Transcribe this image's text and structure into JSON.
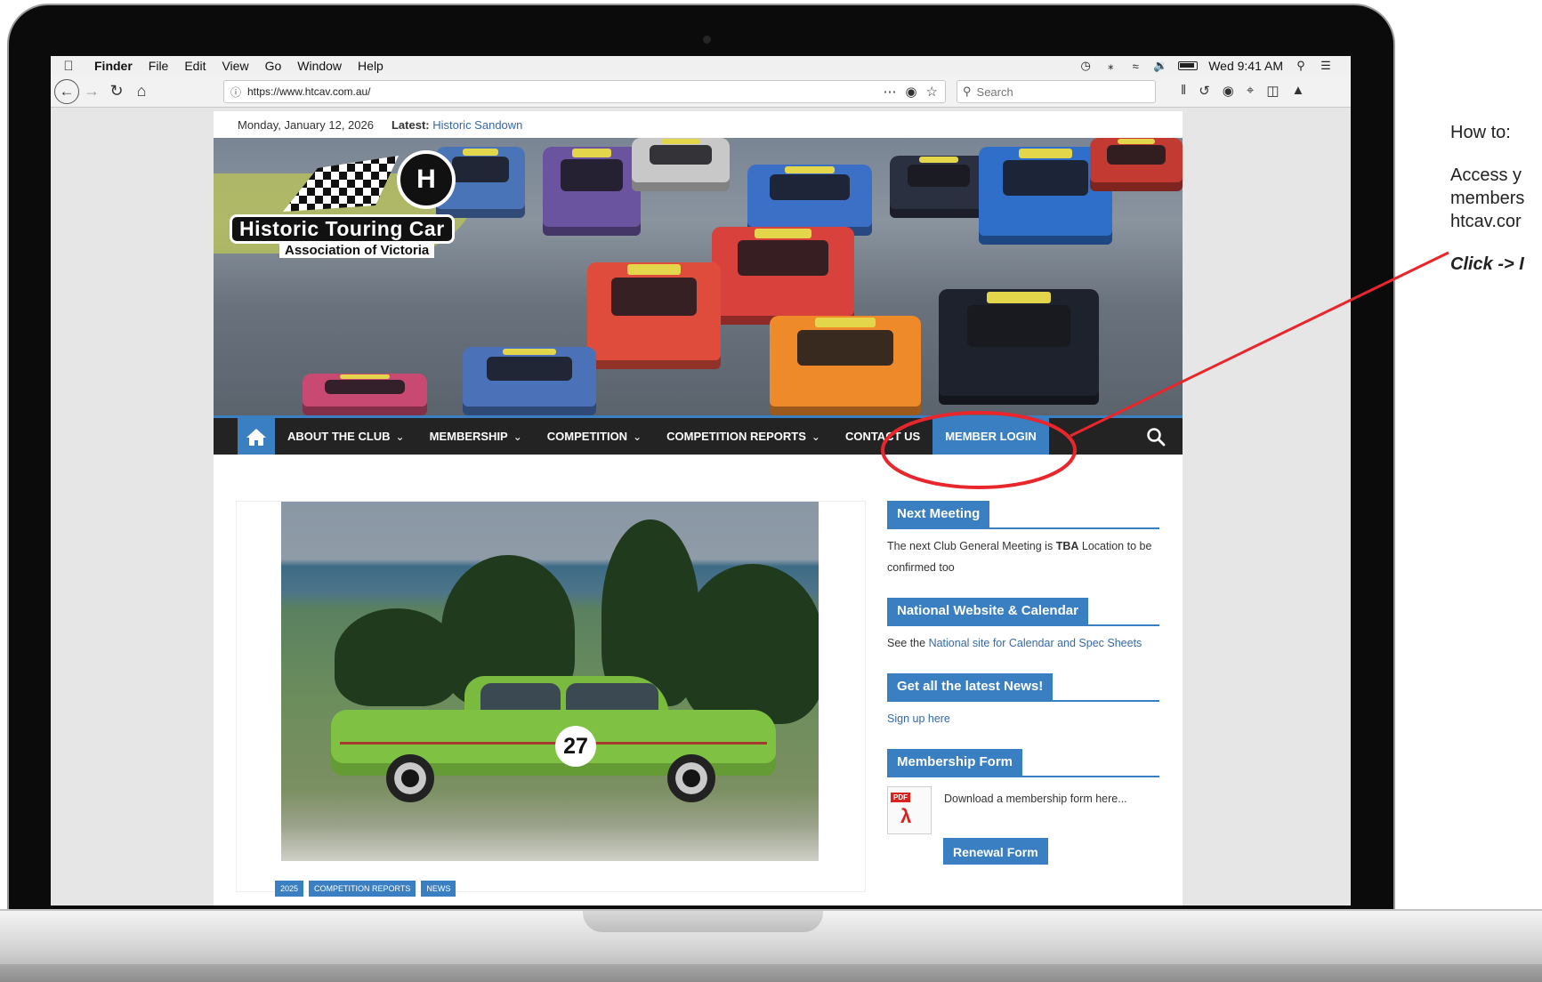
{
  "menubar": {
    "app": "Finder",
    "items": [
      "File",
      "Edit",
      "View",
      "Go",
      "Window",
      "Help"
    ],
    "clock": "Wed 9:41 AM"
  },
  "browser": {
    "url": "https://www.htcav.com.au/",
    "search_placeholder": "Search"
  },
  "site": {
    "date": "Monday, January 12, 2026",
    "latest_label": "Latest:",
    "latest_link": "Historic Sandown",
    "logo_title": "Historic Touring Car",
    "logo_subtitle": "Association of Victoria",
    "logo_knob": "H",
    "nav": {
      "items": [
        {
          "label": "ABOUT THE CLUB",
          "has_dropdown": true
        },
        {
          "label": "MEMBERSHIP",
          "has_dropdown": true
        },
        {
          "label": "COMPETITION",
          "has_dropdown": true
        },
        {
          "label": "COMPETITION REPORTS",
          "has_dropdown": true
        },
        {
          "label": "CONTACT US",
          "has_dropdown": false
        },
        {
          "label": "MEMBER LOGIN",
          "has_dropdown": false,
          "active": true
        }
      ]
    },
    "post": {
      "car_number": "27",
      "tags": [
        "2025",
        "COMPETITION REPORTS",
        "NEWS"
      ]
    },
    "sidebar": {
      "next_meeting": {
        "title": "Next Meeting",
        "text_before": "The next Club General Meeting is ",
        "text_bold": "TBA",
        "text_after": " Location to be confirmed too"
      },
      "national": {
        "title": "National Website & Calendar",
        "text": "See the ",
        "link": "National site for Calendar and Spec Sheets"
      },
      "news": {
        "title": "Get all the latest News!",
        "link": "Sign up here"
      },
      "membership_form": {
        "title": "Membership Form",
        "pdf_label": "PDF",
        "text": "Download a membership form here..."
      },
      "renewal_button": "Renewal Form"
    }
  },
  "annotation": {
    "heading": "How to:",
    "line1": "Access y",
    "line2": "members",
    "line3": "htcav.cor",
    "click": "Click -> I",
    "color": "#e8262b"
  },
  "colors": {
    "accent": "#3a7fc1",
    "nav_bg": "#232323",
    "annotation": "#e8262b"
  }
}
